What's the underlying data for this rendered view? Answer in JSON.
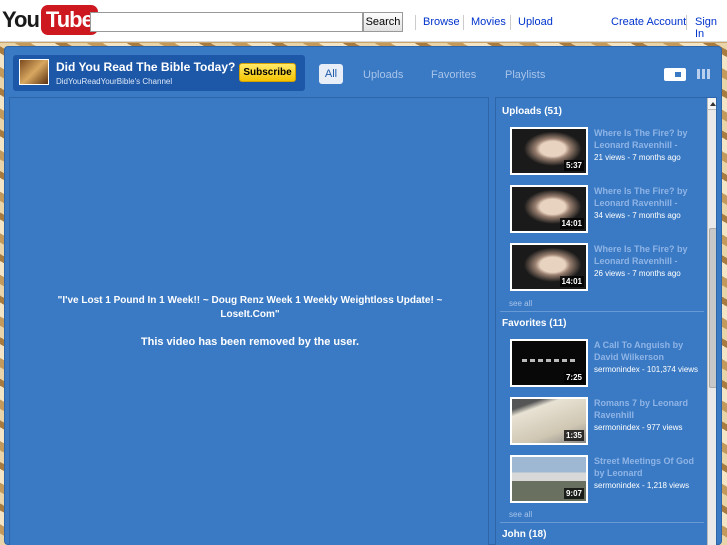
{
  "header": {
    "logo_you": "You",
    "logo_tube": "Tube",
    "search_placeholder": "",
    "search_button": "Search",
    "nav": {
      "browse": "Browse",
      "movies": "Movies",
      "upload": "Upload",
      "create_account": "Create Account",
      "sign_in": "Sign In"
    }
  },
  "channel": {
    "title": "Did You Read The Bible Today?",
    "subtitle": "DidYouReadYourBible's Channel",
    "subscribe": "Subscribe",
    "tabs": {
      "all": "All",
      "uploads": "Uploads",
      "favorites": "Favorites",
      "playlists": "Playlists"
    }
  },
  "player": {
    "title": "\"I've Lost 1 Pound In 1 Week!! ~ Doug Renz Week 1 Weekly Weightloss Update! ~ LoseIt.Com\"",
    "message": "This video has been removed by the user."
  },
  "sidebar": {
    "uploads_title": "Uploads (51)",
    "uploads": [
      {
        "title": "Where Is The Fire? by Leonard Ravenhill -",
        "meta": "21 views - 7 months ago",
        "duration": "5:37"
      },
      {
        "title": "Where Is The Fire? by Leonard Ravenhill -",
        "meta": "34 views - 7 months ago",
        "duration": "14:01"
      },
      {
        "title": "Where Is The Fire? by Leonard Ravenhill -",
        "meta": "26 views - 7 months ago",
        "duration": "14:01"
      }
    ],
    "see_all_1": "see all",
    "favorites_title": "Favorites (11)",
    "favorites": [
      {
        "title": "A Call To Anguish by David Wilkerson",
        "meta": "sermonindex - 101,374 views",
        "duration": "7:25"
      },
      {
        "title": "Romans 7 by Leonard Ravenhill",
        "meta": "sermonindex - 977 views",
        "duration": "1:35"
      },
      {
        "title": "Street Meetings Of God by Leonard",
        "meta": "sermonindex - 1,218 views",
        "duration": "9:07"
      }
    ],
    "see_all_2": "see all",
    "next_section_title": "John (18)"
  }
}
